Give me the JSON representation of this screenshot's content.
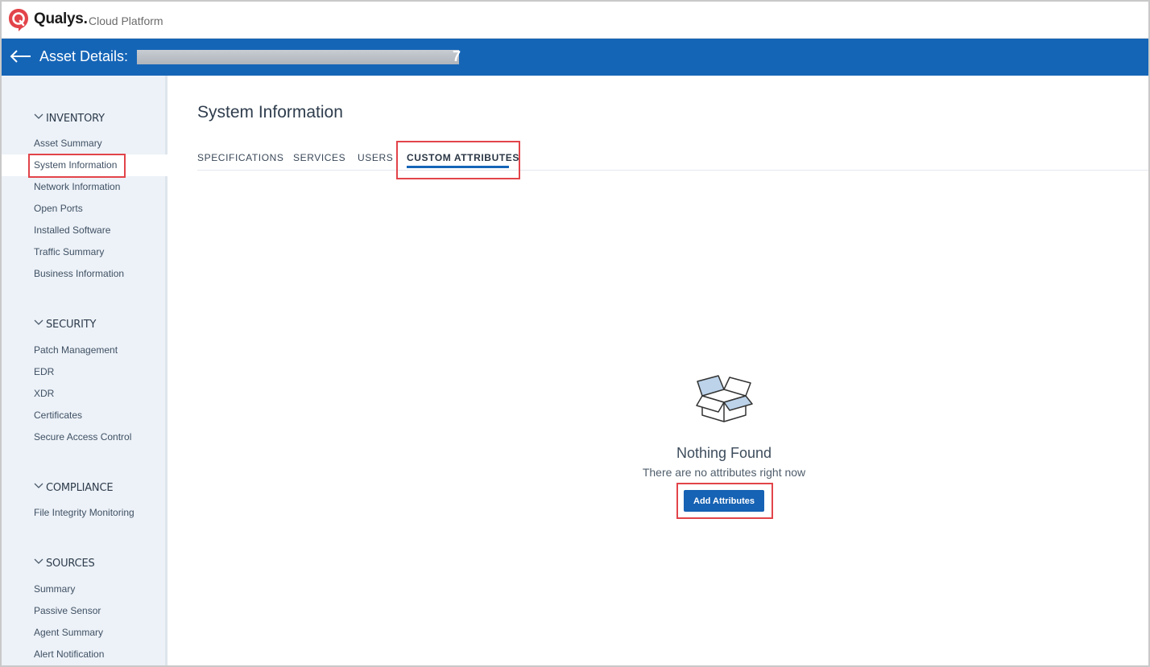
{
  "brand": {
    "name": "Qualys.",
    "product": "Cloud Platform",
    "color": "#1565b7",
    "logo_color": "#e2444a"
  },
  "header": {
    "title": "Asset Details:",
    "asset_name_tail": "7"
  },
  "sidebar": {
    "sections": [
      {
        "title": "INVENTORY",
        "items": [
          "Asset Summary",
          "System Information",
          "Network Information",
          "Open Ports",
          "Installed Software",
          "Traffic Summary",
          "Business Information"
        ]
      },
      {
        "title": "SECURITY",
        "items": [
          "Patch Management",
          "EDR",
          "XDR",
          "Certificates",
          "Secure Access Control"
        ]
      },
      {
        "title": "COMPLIANCE",
        "items": [
          "File Integrity Monitoring"
        ]
      },
      {
        "title": "SOURCES",
        "items": [
          "Summary",
          "Passive Sensor",
          "Agent Summary",
          "Alert Notification"
        ]
      }
    ],
    "active_item": "System Information"
  },
  "main": {
    "title": "System Information",
    "tabs": [
      "SPECIFICATIONS",
      "SERVICES",
      "USERS",
      "CUSTOM ATTRIBUTES"
    ],
    "active_tab": "CUSTOM ATTRIBUTES",
    "empty_state": {
      "icon": "open-box-icon",
      "title": "Nothing Found",
      "message": "There are no attributes right now",
      "button_label": "Add Attributes"
    }
  },
  "highlight_color": "#e2444a"
}
